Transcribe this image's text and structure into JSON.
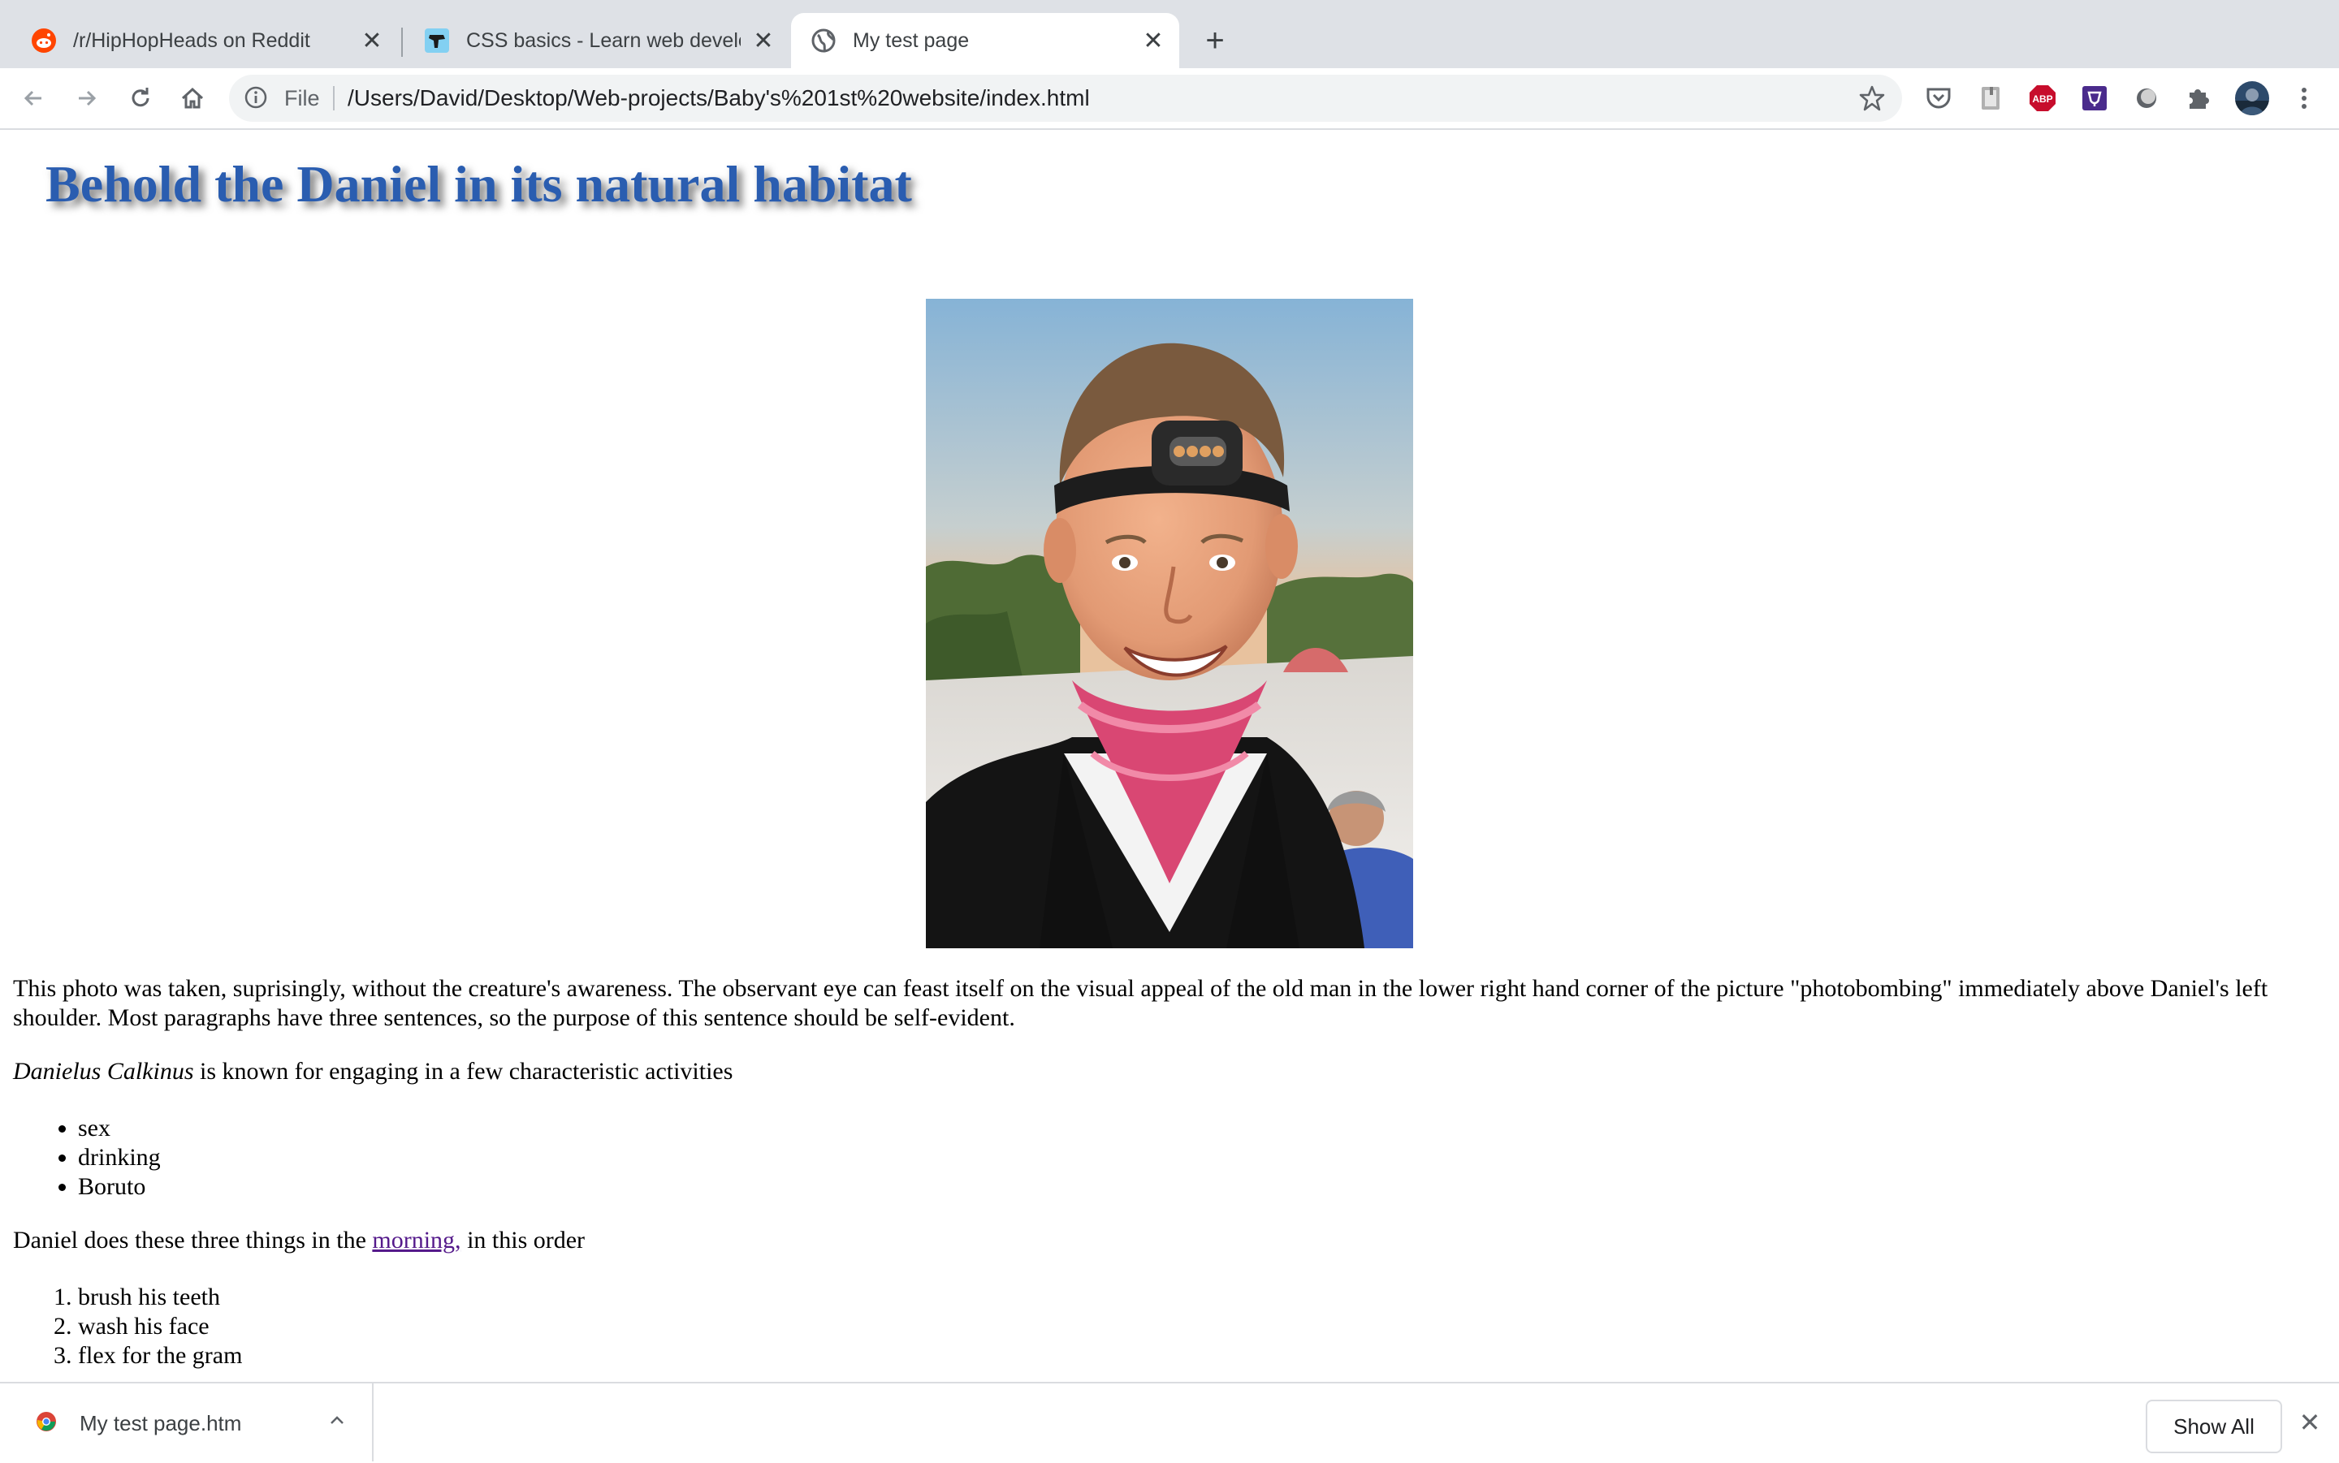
{
  "browser": {
    "tabs": [
      {
        "title": "/r/HipHopHeads on Reddit",
        "icon": "reddit-icon",
        "active": false
      },
      {
        "title": "CSS basics - Learn web develo",
        "icon": "mdn-dino-icon",
        "active": false
      },
      {
        "title": "My test page",
        "icon": "globe-icon",
        "active": true
      }
    ],
    "new_tab_label": "+",
    "close_glyph": "✕"
  },
  "omnibox": {
    "scheme_label": "File",
    "url": "/Users/David/Desktop/Web-projects/Baby's%201st%20website/index.html"
  },
  "toolbar_icons": [
    "back-icon",
    "forward-icon",
    "reload-icon",
    "home-icon",
    "info-icon",
    "bookmark-star-icon",
    "pocket-icon",
    "clipboard-extension-icon",
    "adblock-plus-icon",
    "purple-extension-icon",
    "circle-extension-icon",
    "extensions-puzzle-icon",
    "profile-avatar",
    "more-menu-icon"
  ],
  "page": {
    "heading": "Behold the Daniel in its natural habitat",
    "intro": "This photo was taken, suprisingly, without the creature's awareness. The observant eye can feast itself on the visual appeal of the old man in the lower right hand corner of the picture \"photobombing\" immediately above Daniel's left shoulder. Most paragraphs have three sentences, so the purpose of this sentence should be self-evident.",
    "species_name": "Danielus Calkinus",
    "species_rest": " is known for engaging in a few characteristic activities",
    "activities": [
      "sex",
      "drinking",
      "Boruto"
    ],
    "morning_before": "Daniel does these three things in the ",
    "morning_link": "morning,",
    "morning_after": " in this order",
    "routine": [
      "brush his teeth",
      "wash his face",
      "flex for the gram"
    ]
  },
  "downloads": {
    "file_name": "My test page.htm",
    "show_all": "Show All",
    "close_glyph": "✕"
  },
  "colors": {
    "heading": "#2a5db0",
    "link_visited": "#551a8b",
    "tabstrip": "#dee1e6"
  }
}
